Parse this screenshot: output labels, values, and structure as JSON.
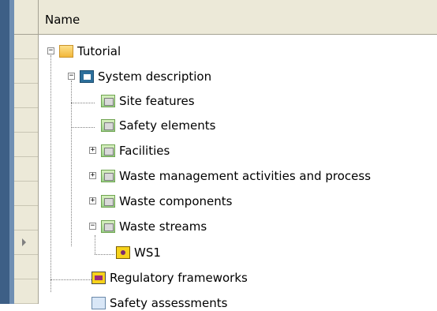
{
  "header": {
    "column_name": "Name"
  },
  "tree": {
    "root": {
      "label": "Tutorial",
      "icon": "folder-yellow-icon",
      "expander": "−"
    },
    "system": {
      "label": "System description",
      "icon": "building-icon",
      "expander": "−"
    },
    "site": {
      "label": "Site features",
      "icon": "folder-green-icon"
    },
    "safety_el": {
      "label": "Safety elements",
      "icon": "folder-green-icon"
    },
    "facilities": {
      "label": "Facilities",
      "icon": "folder-green-icon",
      "expander": "+"
    },
    "waste_mgmt": {
      "label": "Waste management activities and process",
      "icon": "folder-green-icon",
      "expander": "+"
    },
    "waste_comp": {
      "label": "Waste components",
      "icon": "folder-green-icon",
      "expander": "+"
    },
    "waste_streams": {
      "label": "Waste streams",
      "icon": "folder-green-icon",
      "expander": "−"
    },
    "ws1": {
      "label": "WS1",
      "icon": "waste-stream-icon"
    },
    "regulatory": {
      "label": "Regulatory frameworks",
      "icon": "regulatory-icon"
    },
    "safety_assess": {
      "label": "Safety assessments",
      "icon": "safety-assessment-icon"
    }
  }
}
